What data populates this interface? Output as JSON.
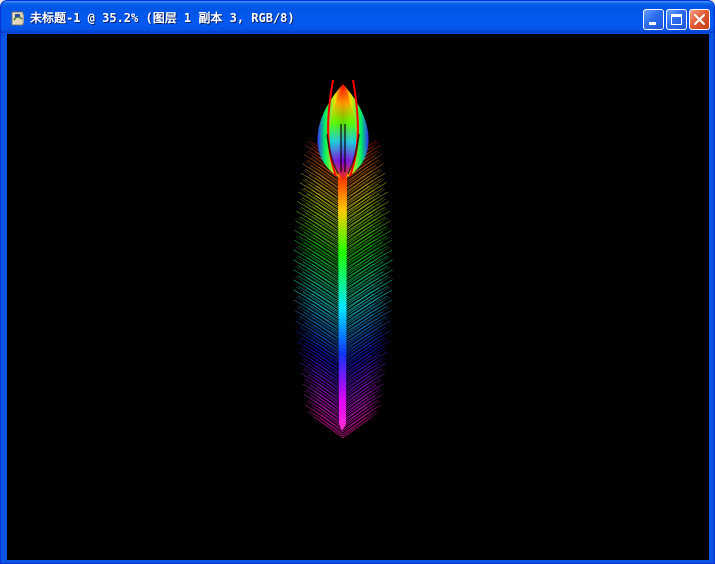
{
  "window": {
    "title": "未标题-1 @ 35.2% (图层 1 副本 3, RGB/8)",
    "app_icon": "photoshop-document-icon",
    "controls": {
      "minimize_icon": "minimize-icon",
      "maximize_icon": "maximize-icon",
      "close_icon": "close-icon"
    }
  },
  "canvas": {
    "background": "#000000",
    "artwork": "rainbow-feather-brush"
  },
  "colors": {
    "titlebar": "#0058ee",
    "frame": "#0a54e3",
    "close_button": "#e25c35"
  }
}
